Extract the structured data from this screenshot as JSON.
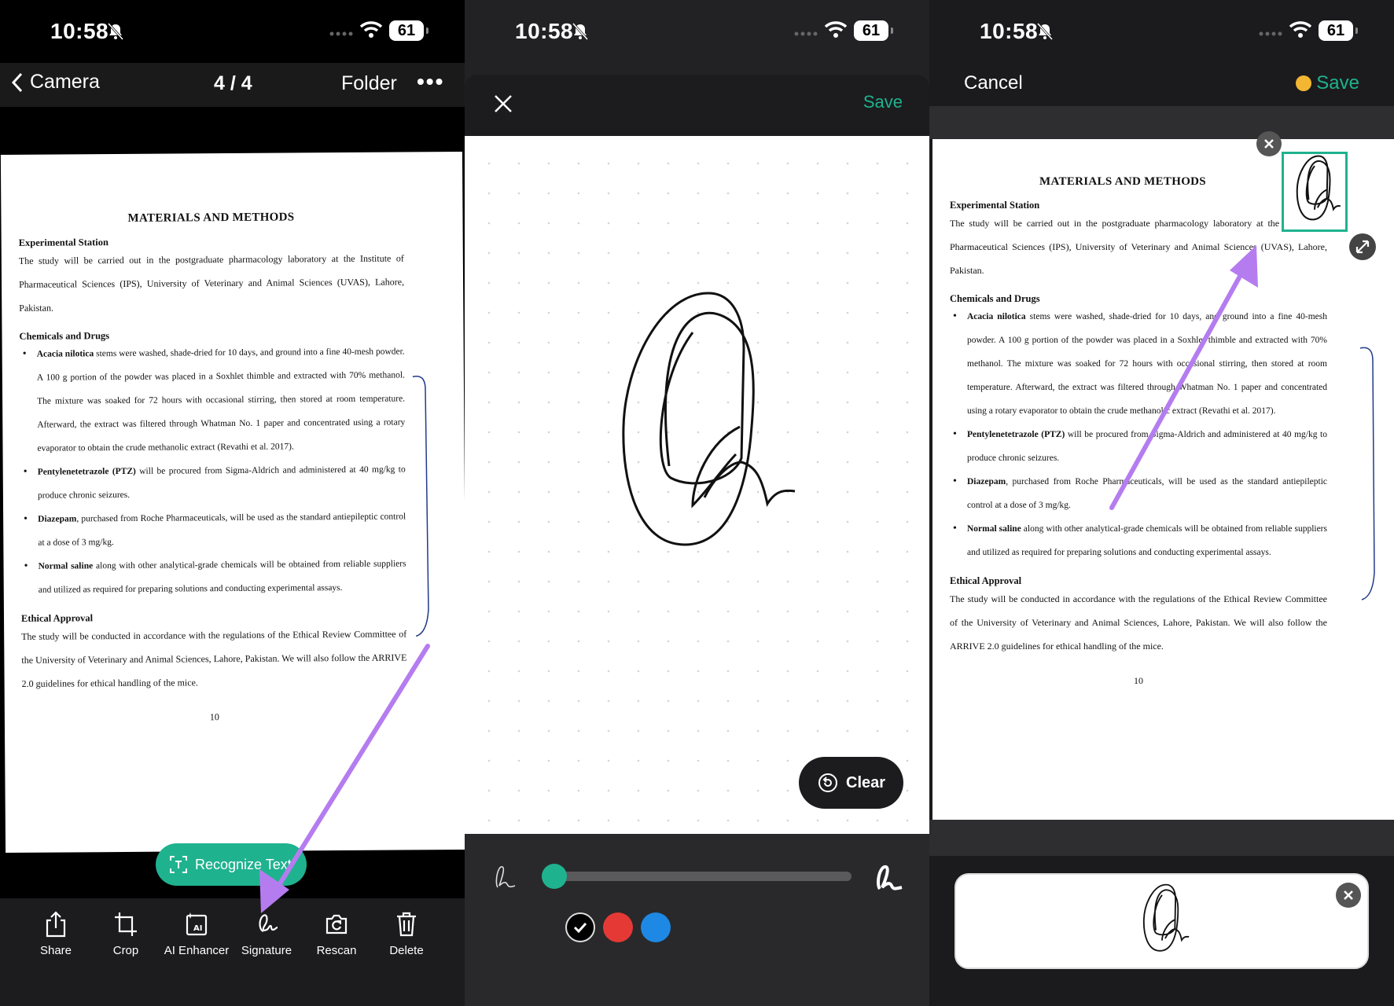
{
  "status_bar": {
    "time": "10:58",
    "battery": "61"
  },
  "panel1": {
    "nav": {
      "back_label": "Camera",
      "page_indicator": "4 / 4",
      "folder_label": "Folder"
    },
    "recognize_label": "Recognize Text",
    "toolbar": [
      {
        "label": "Share",
        "icon": "share-icon"
      },
      {
        "label": "Crop",
        "icon": "crop-icon"
      },
      {
        "label": "AI Enhancer",
        "icon": "ai-enhancer-icon"
      },
      {
        "label": "Signature",
        "icon": "signature-icon"
      },
      {
        "label": "Rescan",
        "icon": "rescan-icon"
      },
      {
        "label": "Delete",
        "icon": "trash-icon"
      }
    ]
  },
  "panel2": {
    "save_label": "Save",
    "clear_label": "Clear",
    "pen_colors": [
      "#000000",
      "#e53935",
      "#1e88e5"
    ],
    "selected_color": "#000000"
  },
  "panel3": {
    "cancel_label": "Cancel",
    "save_label": "Save"
  },
  "document": {
    "title": "MATERIALS AND METHODS",
    "sec1_heading": "Experimental Station",
    "sec1_text": "The study will be carried out in the postgraduate pharmacology laboratory at the Institute of Pharmaceutical Sciences (IPS), University of Veterinary and Animal Sciences (UVAS), Lahore, Pakistan.",
    "sec2_heading": "Chemicals and Drugs",
    "bullets": [
      {
        "bold": "Acacia nilotica",
        "text": " stems were washed, shade-dried for 10 days, and ground into a fine 40-mesh powder. A 100 g portion of the powder was placed in a Soxhlet thimble and extracted with 70% methanol. The mixture was soaked for 72 hours with occasional stirring, then stored at room temperature. Afterward, the extract was filtered through Whatman No. 1 paper and concentrated using a rotary evaporator to obtain the crude methanolic extract (Revathi et al. 2017)."
      },
      {
        "bold": "Pentylenetetrazole (PTZ)",
        "text": " will be procured from Sigma-Aldrich and administered at 40 mg/kg to produce chronic seizures."
      },
      {
        "bold": "Diazepam",
        "text": ", purchased from Roche Pharmaceuticals, will be used as the standard antiepileptic control at a dose of 3 mg/kg."
      },
      {
        "bold": "Normal saline",
        "text": " along with other analytical-grade chemicals will be obtained from reliable suppliers and utilized as required for preparing solutions and conducting experimental assays."
      }
    ],
    "sec3_heading": "Ethical Approval",
    "sec3_text": "The study will be conducted in accordance with the regulations of the Ethical Review Committee of the University of Veterinary and Animal Sciences, Lahore, Pakistan. We will also follow the ARRIVE 2.0 guidelines for ethical handling of the mice.",
    "page_number": "10"
  },
  "colors": {
    "accent": "#1fb28f",
    "annotation_arrow": "#b57cf0"
  }
}
